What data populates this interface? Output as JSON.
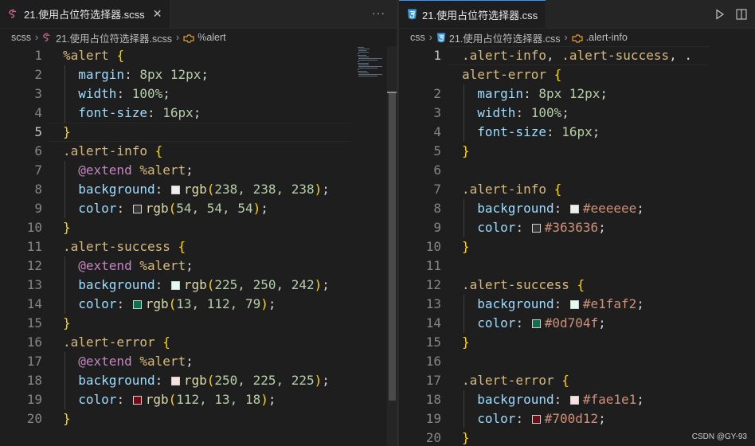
{
  "left": {
    "tab": {
      "label": "21.使用占位符选择器.scss",
      "close": "✕"
    },
    "more": "···",
    "breadcrumb": {
      "folder": "scss",
      "file": "21.使用占位符选择器.scss",
      "symbol": "%alert"
    },
    "current_line": 5,
    "lines": [
      {
        "n": "1",
        "t": [
          [
            "sel",
            "%alert "
          ],
          [
            "br",
            "{"
          ]
        ]
      },
      {
        "n": "2",
        "t": [
          [
            "prop",
            "  margin"
          ],
          [
            "punc",
            ": "
          ],
          [
            "num",
            "8px 12px"
          ],
          [
            "punc",
            ";"
          ]
        ]
      },
      {
        "n": "3",
        "t": [
          [
            "prop",
            "  width"
          ],
          [
            "punc",
            ": "
          ],
          [
            "num",
            "100%"
          ],
          [
            "punc",
            ";"
          ]
        ]
      },
      {
        "n": "4",
        "t": [
          [
            "prop",
            "  font-size"
          ],
          [
            "punc",
            ": "
          ],
          [
            "num",
            "16px"
          ],
          [
            "punc",
            ";"
          ]
        ]
      },
      {
        "n": "5",
        "t": [
          [
            "br",
            "}"
          ]
        ]
      },
      {
        "n": "6",
        "t": [
          [
            "sel",
            ".alert-info "
          ],
          [
            "br",
            "{"
          ]
        ]
      },
      {
        "n": "7",
        "t": [
          [
            "kw",
            "  @extend"
          ],
          [
            "sel",
            " %alert"
          ],
          [
            "punc",
            ";"
          ]
        ]
      },
      {
        "n": "8",
        "t": [
          [
            "prop",
            "  background"
          ],
          [
            "punc",
            ": "
          ],
          [
            "sw",
            "#eeeeee"
          ],
          [
            "fn",
            "rgb"
          ],
          [
            "br",
            "("
          ],
          [
            "num",
            "238, 238, 238"
          ],
          [
            "br",
            ")"
          ],
          [
            "punc",
            ";"
          ]
        ]
      },
      {
        "n": "9",
        "t": [
          [
            "prop",
            "  color"
          ],
          [
            "punc",
            ": "
          ],
          [
            "sw",
            "#363636"
          ],
          [
            "fn",
            "rgb"
          ],
          [
            "br",
            "("
          ],
          [
            "num",
            "54, 54, 54"
          ],
          [
            "br",
            ")"
          ],
          [
            "punc",
            ";"
          ]
        ]
      },
      {
        "n": "10",
        "t": [
          [
            "br",
            "}"
          ]
        ]
      },
      {
        "n": "11",
        "t": [
          [
            "sel",
            ".alert-success "
          ],
          [
            "br",
            "{"
          ]
        ]
      },
      {
        "n": "12",
        "t": [
          [
            "kw",
            "  @extend"
          ],
          [
            "sel",
            " %alert"
          ],
          [
            "punc",
            ";"
          ]
        ]
      },
      {
        "n": "13",
        "t": [
          [
            "prop",
            "  background"
          ],
          [
            "punc",
            ": "
          ],
          [
            "sw",
            "#e1faf2"
          ],
          [
            "fn",
            "rgb"
          ],
          [
            "br",
            "("
          ],
          [
            "num",
            "225, 250, 242"
          ],
          [
            "br",
            ")"
          ],
          [
            "punc",
            ";"
          ]
        ]
      },
      {
        "n": "14",
        "t": [
          [
            "prop",
            "  color"
          ],
          [
            "punc",
            ": "
          ],
          [
            "sw",
            "#0d704f"
          ],
          [
            "fn",
            "rgb"
          ],
          [
            "br",
            "("
          ],
          [
            "num",
            "13, 112, 79"
          ],
          [
            "br",
            ")"
          ],
          [
            "punc",
            ";"
          ]
        ]
      },
      {
        "n": "15",
        "t": [
          [
            "br",
            "}"
          ]
        ]
      },
      {
        "n": "16",
        "t": [
          [
            "sel",
            ".alert-error "
          ],
          [
            "br",
            "{"
          ]
        ]
      },
      {
        "n": "17",
        "t": [
          [
            "kw",
            "  @extend"
          ],
          [
            "sel",
            " %alert"
          ],
          [
            "punc",
            ";"
          ]
        ]
      },
      {
        "n": "18",
        "t": [
          [
            "prop",
            "  background"
          ],
          [
            "punc",
            ": "
          ],
          [
            "sw",
            "#fae1e1"
          ],
          [
            "fn",
            "rgb"
          ],
          [
            "br",
            "("
          ],
          [
            "num",
            "250, 225, 225"
          ],
          [
            "br",
            ")"
          ],
          [
            "punc",
            ";"
          ]
        ]
      },
      {
        "n": "19",
        "t": [
          [
            "prop",
            "  color"
          ],
          [
            "punc",
            ": "
          ],
          [
            "sw",
            "#700d12"
          ],
          [
            "fn",
            "rgb"
          ],
          [
            "br",
            "("
          ],
          [
            "num",
            "112, 13, 18"
          ],
          [
            "br",
            ")"
          ],
          [
            "punc",
            ";"
          ]
        ]
      },
      {
        "n": "20",
        "t": [
          [
            "br",
            "}"
          ]
        ]
      }
    ]
  },
  "right": {
    "tab": {
      "label": "21.使用占位符选择器.css"
    },
    "breadcrumb": {
      "folder": "css",
      "file": "21.使用占位符选择器.css",
      "symbol": ".alert-info"
    },
    "current_line": 1,
    "lines": [
      {
        "n": "1",
        "t": [
          [
            "sel",
            ".alert-info"
          ],
          [
            "punc",
            ", "
          ],
          [
            "sel",
            ".alert-success"
          ],
          [
            "punc",
            ", ."
          ]
        ]
      },
      {
        "n": "",
        "t": [
          [
            "sel",
            "alert-error "
          ],
          [
            "br",
            "{"
          ]
        ]
      },
      {
        "n": "2",
        "t": [
          [
            "prop",
            "  margin"
          ],
          [
            "punc",
            ": "
          ],
          [
            "num",
            "8px 12px"
          ],
          [
            "punc",
            ";"
          ]
        ]
      },
      {
        "n": "3",
        "t": [
          [
            "prop",
            "  width"
          ],
          [
            "punc",
            ": "
          ],
          [
            "num",
            "100%"
          ],
          [
            "punc",
            ";"
          ]
        ]
      },
      {
        "n": "4",
        "t": [
          [
            "prop",
            "  font-size"
          ],
          [
            "punc",
            ": "
          ],
          [
            "num",
            "16px"
          ],
          [
            "punc",
            ";"
          ]
        ]
      },
      {
        "n": "5",
        "t": [
          [
            "br",
            "}"
          ]
        ]
      },
      {
        "n": "6",
        "t": []
      },
      {
        "n": "7",
        "t": [
          [
            "sel",
            ".alert-info "
          ],
          [
            "br",
            "{"
          ]
        ]
      },
      {
        "n": "8",
        "t": [
          [
            "prop",
            "  background"
          ],
          [
            "punc",
            ": "
          ],
          [
            "sw",
            "#eeeeee"
          ],
          [
            "hex",
            "#eeeeee"
          ],
          [
            "punc",
            ";"
          ]
        ]
      },
      {
        "n": "9",
        "t": [
          [
            "prop",
            "  color"
          ],
          [
            "punc",
            ": "
          ],
          [
            "sw",
            "#363636"
          ],
          [
            "hex",
            "#363636"
          ],
          [
            "punc",
            ";"
          ]
        ]
      },
      {
        "n": "10",
        "t": [
          [
            "br",
            "}"
          ]
        ]
      },
      {
        "n": "11",
        "t": []
      },
      {
        "n": "12",
        "t": [
          [
            "sel",
            ".alert-success "
          ],
          [
            "br",
            "{"
          ]
        ]
      },
      {
        "n": "13",
        "t": [
          [
            "prop",
            "  background"
          ],
          [
            "punc",
            ": "
          ],
          [
            "sw",
            "#e1faf2"
          ],
          [
            "hex",
            "#e1faf2"
          ],
          [
            "punc",
            ";"
          ]
        ]
      },
      {
        "n": "14",
        "t": [
          [
            "prop",
            "  color"
          ],
          [
            "punc",
            ": "
          ],
          [
            "sw",
            "#0d704f"
          ],
          [
            "hex",
            "#0d704f"
          ],
          [
            "punc",
            ";"
          ]
        ]
      },
      {
        "n": "15",
        "t": [
          [
            "br",
            "}"
          ]
        ]
      },
      {
        "n": "16",
        "t": []
      },
      {
        "n": "17",
        "t": [
          [
            "sel",
            ".alert-error "
          ],
          [
            "br",
            "{"
          ]
        ]
      },
      {
        "n": "18",
        "t": [
          [
            "prop",
            "  background"
          ],
          [
            "punc",
            ": "
          ],
          [
            "sw",
            "#fae1e1"
          ],
          [
            "hex",
            "#fae1e1"
          ],
          [
            "punc",
            ";"
          ]
        ]
      },
      {
        "n": "19",
        "t": [
          [
            "prop",
            "  color"
          ],
          [
            "punc",
            ": "
          ],
          [
            "sw",
            "#700d12"
          ],
          [
            "hex",
            "#700d12"
          ],
          [
            "punc",
            ";"
          ]
        ]
      },
      {
        "n": "20",
        "t": [
          [
            "br",
            "}"
          ]
        ]
      }
    ]
  },
  "watermark": "CSDN @GY-93",
  "colors": {
    "accent": "#3794ff",
    "scss_icon": "#cd6799",
    "css_icon": "#519aba",
    "symbol_icon": "#ee9d28"
  }
}
